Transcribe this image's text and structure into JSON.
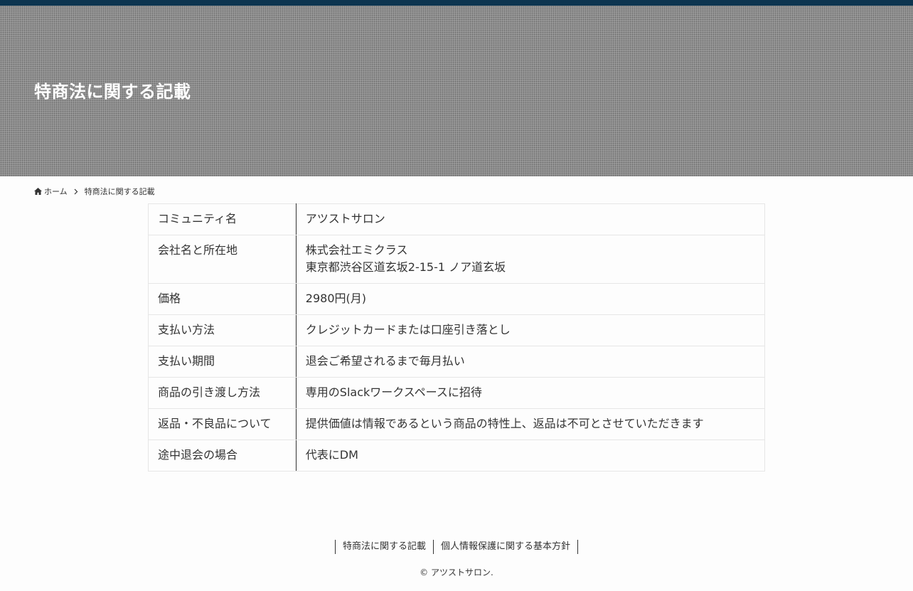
{
  "header": {
    "page_title": "特商法に関する記載"
  },
  "breadcrumb": {
    "home_label": "ホーム",
    "current_label": "特商法に関する記載"
  },
  "spec_table": [
    {
      "label": "コミュニティ名",
      "lines": [
        "アツストサロン"
      ]
    },
    {
      "label": "会社名と所在地",
      "lines": [
        "株式会社エミクラス",
        "東京都渋谷区道玄坂2-15-1 ノア道玄坂"
      ]
    },
    {
      "label": "価格",
      "lines": [
        "2980円(月)"
      ]
    },
    {
      "label": "支払い方法",
      "lines": [
        "クレジットカードまたは口座引き落とし"
      ]
    },
    {
      "label": "支払い期間",
      "lines": [
        "退会ご希望されるまで毎月払い"
      ]
    },
    {
      "label": "商品の引き渡し方法",
      "lines": [
        "専用のSlackワークスペースに招待"
      ]
    },
    {
      "label": "返品・不良品について",
      "lines": [
        "提供価値は情報であるという商品の特性上、返品は不可とさせていただきます"
      ]
    },
    {
      "label": "途中退会の場合",
      "lines": [
        "代表にDM"
      ]
    }
  ],
  "footer": {
    "links": [
      "特商法に関する記載",
      "個人情報保護に関する基本方針"
    ],
    "copyright": "© アツストサロン."
  },
  "colors": {
    "top_bar": "#0d3550",
    "hero_background": "#8c8c8c",
    "text": "#333333"
  },
  "icons": {
    "breadcrumb_home": "home-icon",
    "breadcrumb_separator": "chevron-right-icon"
  }
}
